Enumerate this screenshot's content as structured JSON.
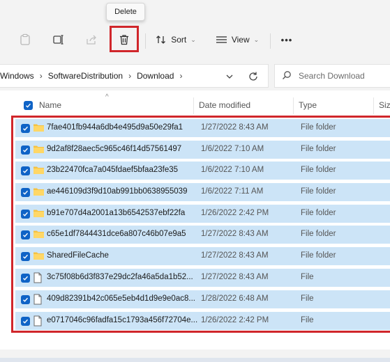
{
  "tooltip": {
    "text": "Delete"
  },
  "toolbar": {
    "sort_label": "Sort",
    "view_label": "View",
    "more_label": "•••"
  },
  "breadcrumb": {
    "items": [
      "Windows",
      "SoftwareDistribution",
      "Download"
    ]
  },
  "search": {
    "placeholder": "Search Download"
  },
  "columns": {
    "name": "Name",
    "date": "Date modified",
    "type": "Type",
    "size": "Siz"
  },
  "rows": [
    {
      "name": "7fae401fb944a6db4e495d9a50e29fa1",
      "date": "1/27/2022 8:43 AM",
      "type": "File folder",
      "icon": "folder-icon",
      "checked": true
    },
    {
      "name": "9d2af8f28aec5c965c46f14d57561497",
      "date": "1/6/2022 7:10 AM",
      "type": "File folder",
      "icon": "folder-icon",
      "checked": true
    },
    {
      "name": "23b22470fca7a045fdaef5bfaa23fe35",
      "date": "1/6/2022 7:10 AM",
      "type": "File folder",
      "icon": "folder-icon",
      "checked": true
    },
    {
      "name": "ae446109d3f9d10ab991bb0638955039",
      "date": "1/6/2022 7:11 AM",
      "type": "File folder",
      "icon": "folder-icon",
      "checked": true
    },
    {
      "name": "b91e707d4a2001a13b6542537ebf22fa",
      "date": "1/26/2022 2:42 PM",
      "type": "File folder",
      "icon": "folder-icon",
      "checked": true
    },
    {
      "name": "c65e1df7844431dce6a807c46b07e9a5",
      "date": "1/27/2022 8:43 AM",
      "type": "File folder",
      "icon": "folder-icon",
      "checked": true
    },
    {
      "name": "SharedFileCache",
      "date": "1/27/2022 8:43 AM",
      "type": "File folder",
      "icon": "folder-icon",
      "checked": true
    },
    {
      "name": "3c75f08b6d3f837e29dc2fa46a5da1b52...",
      "date": "1/27/2022 8:43 AM",
      "type": "File",
      "icon": "file-icon",
      "checked": true
    },
    {
      "name": "409d82391b42c065e5eb4d1d9e9e0ac8...",
      "date": "1/28/2022 6:48 AM",
      "type": "File",
      "icon": "file-icon",
      "checked": true
    },
    {
      "name": "e0717046c96fadfa15c1793a456f72704e...",
      "date": "1/26/2022 2:42 PM",
      "type": "File",
      "icon": "file-icon",
      "checked": true
    }
  ],
  "colors": {
    "accent": "#0f63c6",
    "selection": "#cce4f7",
    "highlight": "#d0262b",
    "folder": "#f5c242"
  }
}
